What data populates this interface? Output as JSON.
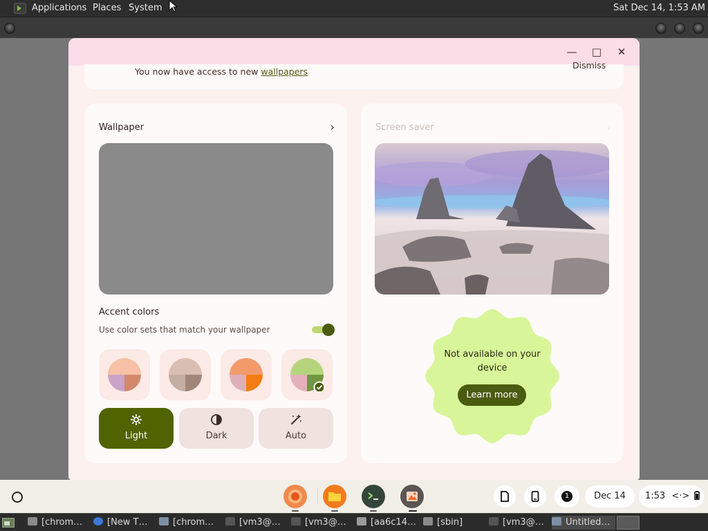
{
  "top_panel": {
    "menus": [
      "Applications",
      "Places",
      "System"
    ],
    "clock": "Sat Dec 14,  1:53 AM"
  },
  "window": {
    "minimize_glyph": "—",
    "maximize_glyph": "□",
    "close_glyph": "✕"
  },
  "banner": {
    "text": "You now have access to new ",
    "link": "wallpapers",
    "dismiss": "Dismiss"
  },
  "wallpaper_card": {
    "title": "Wallpaper",
    "accent_title": "Accent colors",
    "accent_subtitle": "Use color sets that match your wallpaper",
    "accent_toggle_on": true,
    "swatches": [
      {
        "top": "#f6c1a6",
        "bottom_left": "#c9a3c8",
        "bottom_right": "#d3886a",
        "selected": false
      },
      {
        "top": "#d9bfb3",
        "bottom_left": "#c4ada3",
        "bottom_right": "#a18679",
        "selected": false
      },
      {
        "top": "#f29a6a",
        "bottom_left": "#e0aeb9",
        "bottom_right": "#f47c12",
        "selected": false
      },
      {
        "top": "#b6d47c",
        "bottom_left": "#e3b0bb",
        "bottom_right": "#6f9840",
        "selected": true
      }
    ],
    "modes": [
      {
        "label": "Light",
        "icon": "brightness-icon",
        "active": true
      },
      {
        "label": "Dark",
        "icon": "contrast-icon",
        "active": false
      },
      {
        "label": "Auto",
        "icon": "magic-wand-icon",
        "active": false
      }
    ]
  },
  "screensaver_card": {
    "title": "Screen saver",
    "unavailable_text": "Not available on your device",
    "learn_more": "Learn more"
  },
  "shelf": {
    "tray_date": "Dec 14",
    "tray_time": "1:53",
    "notification_count": "1"
  },
  "taskbar": {
    "items": [
      {
        "label": "[chrom…",
        "icon": "folder-icon"
      },
      {
        "label": "[New T…",
        "icon": "chrome-icon"
      },
      {
        "label": "[chrom…",
        "icon": "window-icon"
      },
      {
        "label": "[vm3@…",
        "icon": "terminal-icon"
      },
      {
        "label": "[vm3@…",
        "icon": "terminal-icon"
      },
      {
        "label": "[aa6c14…",
        "icon": "drive-icon"
      },
      {
        "label": "[sbin]",
        "icon": "folder-icon"
      },
      {
        "label": "[vm3@…",
        "icon": "terminal-icon"
      },
      {
        "label": "Untitled…",
        "icon": "window-icon"
      }
    ]
  }
}
